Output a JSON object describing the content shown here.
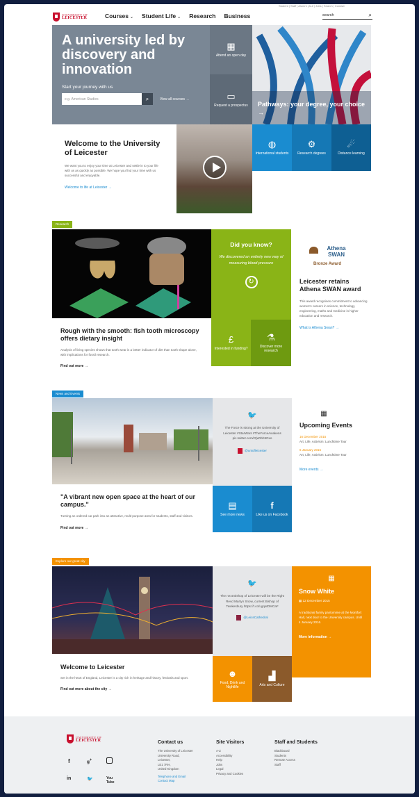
{
  "header": {
    "util_links": "Student | Staff | Alumni | A-Z | Jobs | Search | Contact",
    "logo_line1": "UNIVERSITY OF",
    "logo_line2": "LEICESTER",
    "nav": [
      {
        "label": "Courses",
        "has_menu": true
      },
      {
        "label": "Student Life",
        "has_menu": true
      },
      {
        "label": "Research",
        "has_menu": false
      },
      {
        "label": "Business",
        "has_menu": false
      }
    ],
    "search_placeholder": "search"
  },
  "hero": {
    "headline": "A university led by discovery and innovation",
    "start_label": "Start your journey with us",
    "search_placeholder": "e.g. American Studies",
    "view_all": "View all courses",
    "open_day": "Attend an open day",
    "prospectus": "Request a prospectus",
    "pathways": "Pathways: your degree, your choice"
  },
  "welcome": {
    "title": "Welcome to the University of Leicester",
    "body": "We want you to enjoy your time at Leicester and settle in to your life with us as quickly as possible. We hope you find your time with us successful and enjoyable.",
    "link": "Welcome to life at Leicester",
    "tiles": [
      {
        "label": "International students",
        "icon": "globe-icon"
      },
      {
        "label": "Research degrees",
        "icon": "gears-icon"
      },
      {
        "label": "Distance learning",
        "icon": "person-icon"
      }
    ]
  },
  "research": {
    "label": "Research",
    "title": "Rough with the smooth: fish tooth microscopy offers dietary insight",
    "body": "Analysis of living species shows that tooth wear is a better indicator of diet than tooth shape alone, with implications for fossil research.",
    "find_more": "Find out more",
    "did_you_know_title": "Did you know?",
    "did_you_know_text": "We discovered an entirely new way of measuring blood pressure",
    "funding": "Interested in funding?",
    "discover": "Discover more research",
    "athena_logo": "Athena SWAN",
    "athena_award": "Bronze Award",
    "athena_title": "Leicester retains Athena SWAN award",
    "athena_body": "This award recognises commitment to advancing women's careers in science, technology, engineering, maths and medicine in higher education and research.",
    "athena_link": "What is Athena Swan?"
  },
  "news": {
    "label": "News and Events",
    "title": "\"A vibrant new open space at the heart of our campus.\"",
    "body": "Turning an ordered car park into an attractive, multi-purpose area for students, staff and visitors.",
    "find_more": "Find out more",
    "tweet": "The Force is strong at the University of Leicester #StarWars #TheForceAwakens pic.twitter.com/GjWrbh9Oxo",
    "tweet_handle": "@uniofleicester",
    "see_news": "See more news",
    "facebook": "Like us on Facebook",
    "events_title": "Upcoming Events",
    "events": [
      {
        "date": "16 December 2015",
        "name": "Art, Life, Activism: Lunchtime Tour"
      },
      {
        "date": "6 January 2016",
        "name": "Art, Life, Activism: Lunchtime Tour"
      }
    ],
    "more_events": "More events"
  },
  "city": {
    "label": "Explore our great city",
    "title": "Welcome to Leicester",
    "body": "Set in the heart of England, Leicester is a city rich in heritage and history, festivals and sport.",
    "find_more": "Find out more about the city",
    "tweet": "The next Bishop of Leicester will be the Right Revd Martyn Snow, current Bishop of Tewkesbury https://t.co/LgqatDMCaF",
    "tweet_handle": "@LeicsCathedral",
    "food": "Food, Drink and Nightlife",
    "arts": "Arts and Culture",
    "event_title": "Snow White",
    "event_date": "12 December 2015",
    "event_body": "A traditional family pantomime at the Montfort Hall, next door to the University campus. Until 4 January 2016.",
    "more_info": "More information"
  },
  "footer": {
    "logo_line1": "UNIVERSITY OF",
    "logo_line2": "LEICESTER",
    "social": [
      "f",
      "g+",
      "ig",
      "in",
      "tw",
      "yt"
    ],
    "contact_title": "Contact us",
    "contact_lines": [
      "The University of Leicester",
      "University Road,",
      "Leicester,",
      "LE1 7RH,",
      "United Kingdom"
    ],
    "contact_links": [
      "Telephone and Email",
      "Contact Map"
    ],
    "visitors_title": "Site Visitors",
    "visitors": [
      "A-Z",
      "Accessibility",
      "Help",
      "Jobs",
      "Legal",
      "Privacy and Cookies"
    ],
    "staff_title": "Staff and Students",
    "staff": [
      "Blackboard",
      "Students",
      "Remote Access",
      "Staff"
    ]
  },
  "colors": {
    "grey": "#7a8795",
    "blue": "#1a8cd0",
    "green": "#8ab417",
    "orange": "#f39200",
    "brown": "#8b5a2b",
    "red": "#c8102e"
  }
}
